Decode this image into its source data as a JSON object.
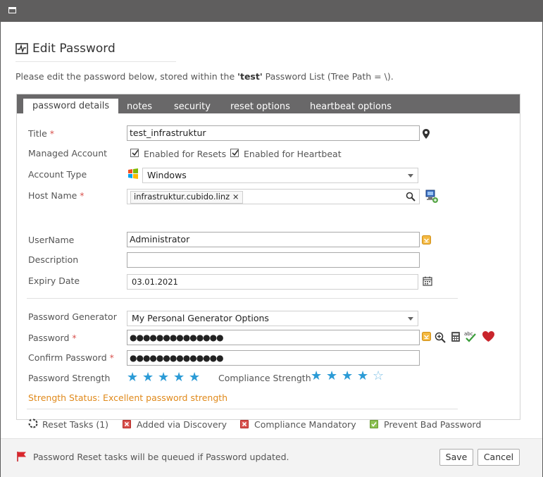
{
  "dialog": {
    "title": "Edit Password",
    "intro_pre": "Please edit the password below, stored within the ",
    "intro_list": "'test'",
    "intro_post": " Password List (Tree Path = \\).",
    "tabs": [
      "password details",
      "notes",
      "security",
      "reset options",
      "heartbeat options"
    ],
    "active_tab": "password details"
  },
  "form": {
    "title_label": "Title",
    "title_value": "test_infrastruktur",
    "managed_label": "Managed Account",
    "enabled_resets": "Enabled for Resets",
    "enabled_heartbeat": "Enabled for Heartbeat",
    "account_type_label": "Account Type",
    "account_type_value": "Windows",
    "host_label": "Host Name",
    "host_tag": "infrastruktur.cubido.linz",
    "username_label": "UserName",
    "username_value": "Administrator",
    "description_label": "Description",
    "description_value": "",
    "expiry_label": "Expiry Date",
    "expiry_value": "03.01.2021",
    "generator_label": "Password Generator",
    "generator_value": "My Personal Generator Options",
    "password_label": "Password",
    "password_value": "●●●●●●●●●●●●●●",
    "confirm_label": "Confirm Password",
    "confirm_value": "●●●●●●●●●●●●●●",
    "strength_label": "Password Strength",
    "strength_stars": 5,
    "compliance_label": "Compliance Strength",
    "compliance_stars": 4,
    "stars_max": 5,
    "strength_status": "Strength Status: Excellent password strength",
    "reset_tasks": "Reset Tasks (1)",
    "added_discovery": "Added via Discovery",
    "compliance_mandatory": "Compliance Mandatory",
    "prevent_bad": "Prevent Bad Password"
  },
  "footer": {
    "message": "Password Reset tasks will be queued if Password updated.",
    "save": "Save",
    "cancel": "Cancel"
  },
  "colors": {
    "accent_star": "#2b9bd6",
    "status_orange": "#e0891a",
    "badge_red": "#d9534f",
    "badge_green": "#8cc152",
    "heart": "#c9252c"
  }
}
